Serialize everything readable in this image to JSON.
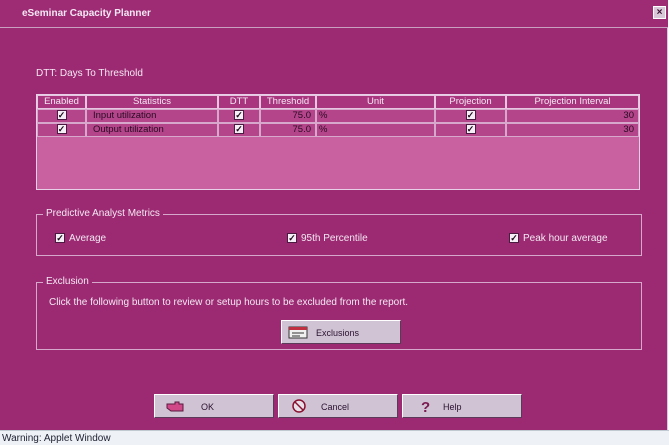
{
  "window": {
    "title": "eSeminar Capacity Planner",
    "close_glyph": "×"
  },
  "dtt_label": "DTT: Days To Threshold",
  "table": {
    "headers": [
      "Enabled",
      "Statistics",
      "DTT",
      "Threshold",
      "Unit",
      "Projection",
      "Projection Interval"
    ],
    "rows": [
      {
        "enabled": true,
        "statistic": "Input utilization",
        "dtt": true,
        "threshold": "75.0",
        "unit": "%",
        "projection": true,
        "interval": "30"
      },
      {
        "enabled": true,
        "statistic": "Output utilization",
        "dtt": true,
        "threshold": "75.0",
        "unit": "%",
        "projection": true,
        "interval": "30"
      }
    ]
  },
  "metrics": {
    "legend": "Predictive Analyst Metrics",
    "options": [
      {
        "label": "Average",
        "checked": true
      },
      {
        "label": "95th Percentile",
        "checked": true
      },
      {
        "label": "Peak hour average",
        "checked": true
      }
    ]
  },
  "exclusion": {
    "legend": "Exclusion",
    "description": "Click the following button to review or setup hours to be excluded from the report.",
    "button_label": "Exclusions"
  },
  "buttons": {
    "ok": "OK",
    "cancel": "Cancel",
    "help": "Help"
  },
  "status": {
    "text": "Warning: Applet Window"
  },
  "icons": {
    "ok": "hand-pointer-icon",
    "cancel": "cancel-circle-icon",
    "help": "question-mark-icon",
    "exclusions": "calendar-icon"
  },
  "colors": {
    "background": "#9c2a72",
    "table": "#c9609f",
    "button": "#d0c4d4"
  }
}
